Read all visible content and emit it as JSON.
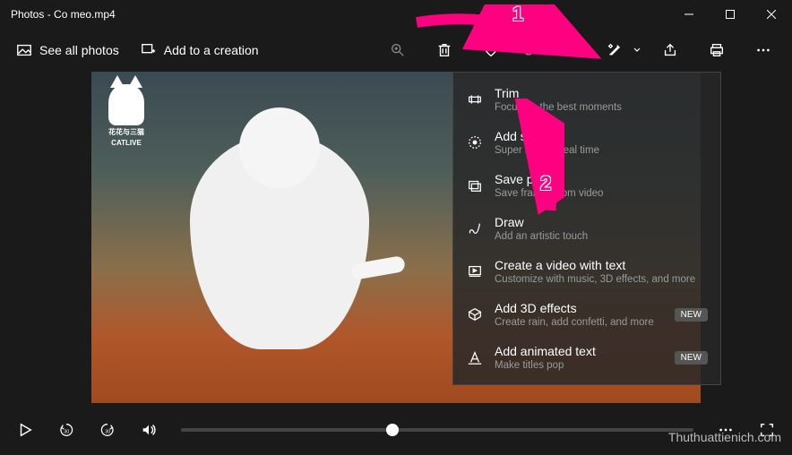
{
  "titlebar": {
    "title": "Photos - Co meo.mp4"
  },
  "toolbar": {
    "see_all": "See all photos",
    "add_creation": "Add to a creation"
  },
  "watermark": {
    "logo_text_top": "花花与三猫",
    "logo_text_bottom": "CATLIVE"
  },
  "dropdown": {
    "items": [
      {
        "title": "Trim",
        "desc": "Focus on the best moments",
        "badge": ""
      },
      {
        "title": "Add slo-mo",
        "desc": "Super slow to real time",
        "badge": ""
      },
      {
        "title": "Save photos",
        "desc": "Save frames from video",
        "badge": ""
      },
      {
        "title": "Draw",
        "desc": "Add an artistic touch",
        "badge": ""
      },
      {
        "title": "Create a video with text",
        "desc": "Customize with music, 3D effects, and more",
        "badge": ""
      },
      {
        "title": "Add 3D effects",
        "desc": "Create rain, add confetti, and more",
        "badge": "NEW"
      },
      {
        "title": "Add animated text",
        "desc": "Make titles pop",
        "badge": "NEW"
      }
    ]
  },
  "annotations": {
    "label1": "1",
    "label2": "2"
  },
  "site_watermark": "Thuthuattienich.com"
}
